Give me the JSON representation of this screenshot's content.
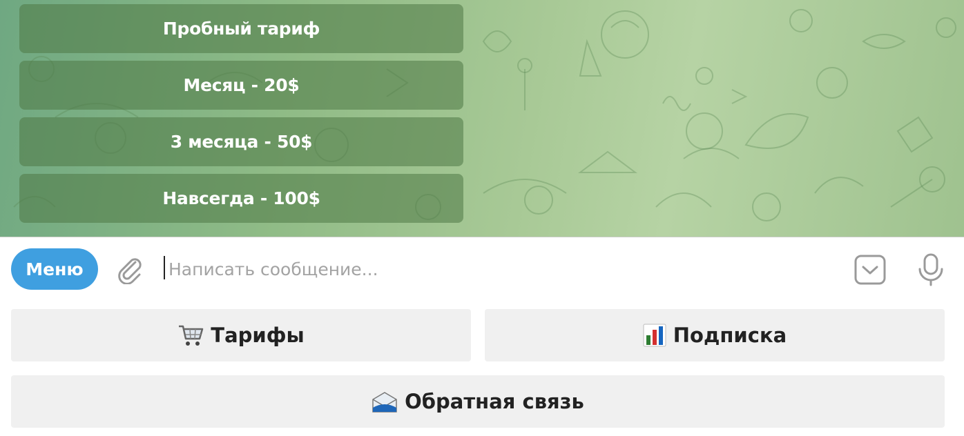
{
  "inline_keyboard": {
    "buttons": [
      {
        "label": "Пробный тариф"
      },
      {
        "label": "Месяц - 20$"
      },
      {
        "label": "3 месяца - 50$"
      },
      {
        "label": "Навсегда - 100$"
      }
    ]
  },
  "input_bar": {
    "menu_label": "Меню",
    "placeholder": "Написать сообщение...",
    "value": ""
  },
  "reply_keyboard": {
    "tariffs_label": "Тарифы",
    "tariffs_icon": "shopping-cart-icon",
    "subscription_label": "Подписка",
    "subscription_icon": "bar-chart-icon",
    "feedback_label": "Обратная связь",
    "feedback_icon": "incoming-envelope-icon"
  },
  "colors": {
    "menu_button": "#3f9fe0",
    "inline_button_bg": "rgba(78,120,70,0.55)",
    "reply_button_bg": "#f0f0f0"
  }
}
